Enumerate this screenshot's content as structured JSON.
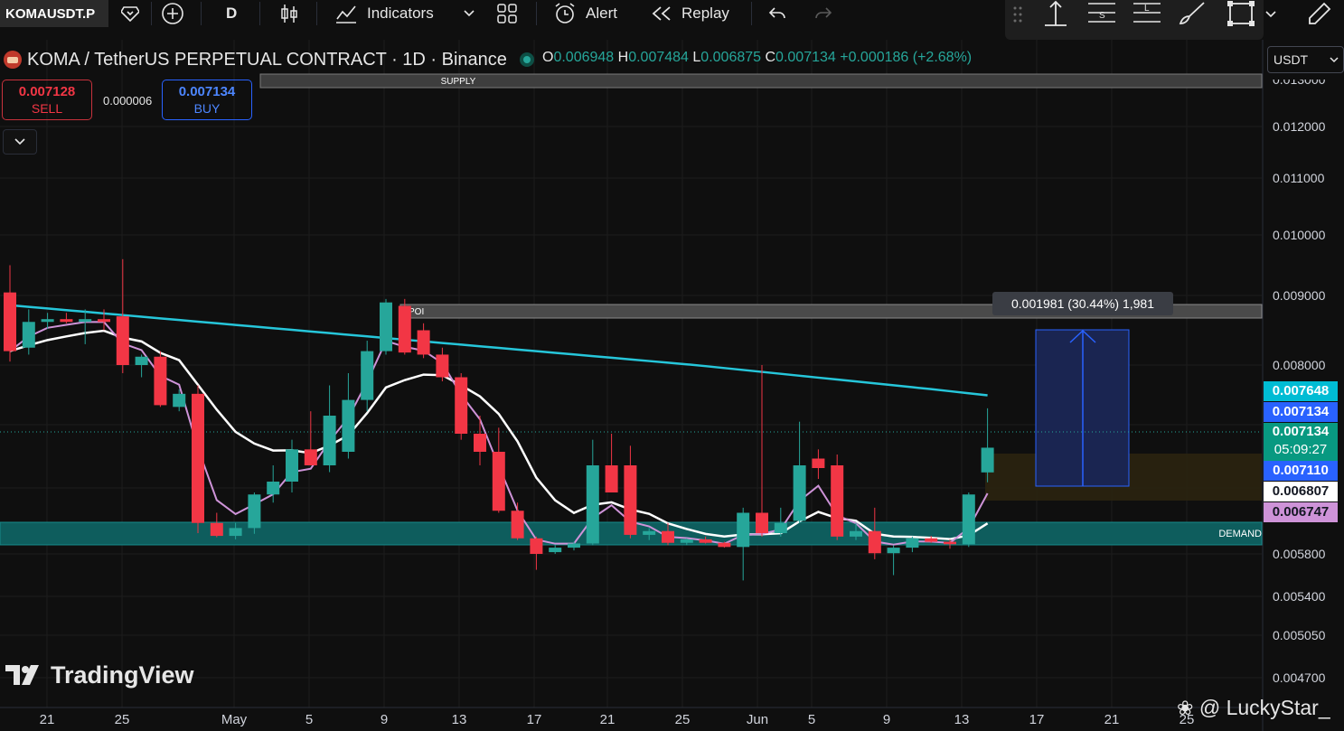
{
  "toolbar": {
    "symbol": "KOMAUSDT.P",
    "interval": "D",
    "indicators_label": "Indicators",
    "alert_label": "Alert",
    "replay_label": "Replay"
  },
  "legend": {
    "title": "KOMA / TetherUS PERPETUAL CONTRACT · 1D · Binance",
    "o_key": "O",
    "o_val": "0.006948",
    "h_key": "H",
    "h_val": "0.007484",
    "l_key": "L",
    "l_val": "0.006875",
    "c_key": "C",
    "c_val": "0.007134",
    "change": "+0.000186 (+2.68%)"
  },
  "trade": {
    "sell_price": "0.007128",
    "sell_label": "SELL",
    "spread": "0.000006",
    "buy_price": "0.007134",
    "buy_label": "BUY"
  },
  "currency": "USDT",
  "zones": {
    "supply": "SUPPLY",
    "poi": "POI",
    "demand": "DEMAND"
  },
  "measure": {
    "label": "0.001981 (30.44%) 1,981"
  },
  "price_axis": {
    "ticks": [
      "0.013000",
      "0.012000",
      "0.011000",
      "0.010000",
      "0.009000",
      "0.008000",
      "0.005800",
      "0.005400",
      "0.005050",
      "0.004700"
    ],
    "labels": [
      {
        "text": "0.007648",
        "bg": "#00bcd4",
        "fg": "#ffffff"
      },
      {
        "text": "0.007134",
        "bg": "#2962ff",
        "fg": "#ffffff"
      },
      {
        "text": "0.007134",
        "bg": "#089981",
        "fg": "#ffffff",
        "sub": "05:09:27"
      },
      {
        "text": "0.007110",
        "bg": "#2962ff",
        "fg": "#ffffff"
      },
      {
        "text": "0.006807",
        "bg": "#ffffff",
        "fg": "#131722"
      },
      {
        "text": "0.006747",
        "bg": "#ce93d8",
        "fg": "#131722"
      }
    ]
  },
  "time_axis": [
    "21",
    "25",
    "May",
    "5",
    "9",
    "13",
    "17",
    "21",
    "25",
    "Jun",
    "5",
    "9",
    "13",
    "17",
    "21",
    "25"
  ],
  "branding": {
    "logo_text": "TradingView",
    "watermark": "@ LuckyStar_"
  },
  "colors": {
    "up": "#26a69a",
    "down": "#f23645",
    "ema_long": "#26c6da",
    "ema_mid": "#ffffff",
    "ema_short": "#ce93d8",
    "background": "#0f0f0f"
  },
  "candles": [
    {
      "o": 0.00905,
      "h": 0.0095,
      "l": 0.00805,
      "c": 0.0082
    },
    {
      "o": 0.00825,
      "h": 0.0088,
      "l": 0.00815,
      "c": 0.00862
    },
    {
      "o": 0.00862,
      "h": 0.00875,
      "l": 0.00852,
      "c": 0.00866
    },
    {
      "o": 0.00866,
      "h": 0.00875,
      "l": 0.0086,
      "c": 0.00862
    },
    {
      "o": 0.00862,
      "h": 0.0088,
      "l": 0.0083,
      "c": 0.00866
    },
    {
      "o": 0.00866,
      "h": 0.0088,
      "l": 0.0085,
      "c": 0.00862
    },
    {
      "o": 0.0087,
      "h": 0.0096,
      "l": 0.0079,
      "c": 0.008
    },
    {
      "o": 0.008,
      "h": 0.00815,
      "l": 0.00785,
      "c": 0.00812
    },
    {
      "o": 0.00812,
      "h": 0.0082,
      "l": 0.0075,
      "c": 0.00752
    },
    {
      "o": 0.0075,
      "h": 0.0077,
      "l": 0.00745,
      "c": 0.00765
    },
    {
      "o": 0.00765,
      "h": 0.00775,
      "l": 0.0064,
      "c": 0.0065
    },
    {
      "o": 0.0065,
      "h": 0.0066,
      "l": 0.00628,
      "c": 0.00632
    },
    {
      "o": 0.00632,
      "h": 0.0065,
      "l": 0.00622,
      "c": 0.00645
    },
    {
      "o": 0.00645,
      "h": 0.0068,
      "l": 0.00638,
      "c": 0.00678
    },
    {
      "o": 0.00678,
      "h": 0.007,
      "l": 0.0067,
      "c": 0.00688
    },
    {
      "o": 0.00688,
      "h": 0.0072,
      "l": 0.0068,
      "c": 0.00712
    },
    {
      "o": 0.00712,
      "h": 0.00745,
      "l": 0.007,
      "c": 0.007
    },
    {
      "o": 0.007,
      "h": 0.00775,
      "l": 0.00695,
      "c": 0.0074
    },
    {
      "o": 0.0071,
      "h": 0.0079,
      "l": 0.00705,
      "c": 0.00758
    },
    {
      "o": 0.00758,
      "h": 0.00835,
      "l": 0.00745,
      "c": 0.0082
    },
    {
      "o": 0.0082,
      "h": 0.00895,
      "l": 0.00815,
      "c": 0.0089
    },
    {
      "o": 0.00885,
      "h": 0.00895,
      "l": 0.00815,
      "c": 0.00818
    },
    {
      "o": 0.0085,
      "h": 0.0086,
      "l": 0.0081,
      "c": 0.00815
    },
    {
      "o": 0.00815,
      "h": 0.00825,
      "l": 0.0078,
      "c": 0.00785
    },
    {
      "o": 0.00785,
      "h": 0.0079,
      "l": 0.0072,
      "c": 0.00725
    },
    {
      "o": 0.00725,
      "h": 0.0074,
      "l": 0.007,
      "c": 0.0071
    },
    {
      "o": 0.0071,
      "h": 0.0073,
      "l": 0.0066,
      "c": 0.00662
    },
    {
      "o": 0.00662,
      "h": 0.0067,
      "l": 0.0062,
      "c": 0.00625
    },
    {
      "o": 0.00625,
      "h": 0.0063,
      "l": 0.00565,
      "c": 0.0058
    },
    {
      "o": 0.00585,
      "h": 0.00605,
      "l": 0.0058,
      "c": 0.00598
    },
    {
      "o": 0.00598,
      "h": 0.00615,
      "l": 0.0059,
      "c": 0.0061
    },
    {
      "o": 0.0061,
      "h": 0.0072,
      "l": 0.00605,
      "c": 0.007
    },
    {
      "o": 0.007,
      "h": 0.00725,
      "l": 0.0069,
      "c": 0.0068
    },
    {
      "o": 0.007,
      "h": 0.00715,
      "l": 0.00625,
      "c": 0.00635
    },
    {
      "o": 0.00635,
      "h": 0.00645,
      "l": 0.0062,
      "c": 0.00642
    },
    {
      "o": 0.00642,
      "h": 0.0065,
      "l": 0.00605,
      "c": 0.00612
    },
    {
      "o": 0.00612,
      "h": 0.00625,
      "l": 0.00605,
      "c": 0.00622
    },
    {
      "o": 0.00622,
      "h": 0.0063,
      "l": 0.0061,
      "c": 0.00612
    },
    {
      "o": 0.00612,
      "h": 0.00615,
      "l": 0.00598,
      "c": 0.006
    },
    {
      "o": 0.006,
      "h": 0.00665,
      "l": 0.00555,
      "c": 0.0066
    },
    {
      "o": 0.0066,
      "h": 0.008,
      "l": 0.0063,
      "c": 0.0064
    },
    {
      "o": 0.0064,
      "h": 0.00665,
      "l": 0.0063,
      "c": 0.0065
    },
    {
      "o": 0.00652,
      "h": 0.00735,
      "l": 0.0065,
      "c": 0.007
    },
    {
      "o": 0.00705,
      "h": 0.00712,
      "l": 0.0069,
      "c": 0.00698
    },
    {
      "o": 0.007,
      "h": 0.00708,
      "l": 0.0062,
      "c": 0.0063
    },
    {
      "o": 0.0063,
      "h": 0.0065,
      "l": 0.0062,
      "c": 0.00642
    },
    {
      "o": 0.00642,
      "h": 0.00665,
      "l": 0.00575,
      "c": 0.00582
    },
    {
      "o": 0.00582,
      "h": 0.00605,
      "l": 0.0056,
      "c": 0.00598
    },
    {
      "o": 0.00598,
      "h": 0.0063,
      "l": 0.00585,
      "c": 0.00625
    },
    {
      "o": 0.00625,
      "h": 0.00632,
      "l": 0.00612,
      "c": 0.00615
    },
    {
      "o": 0.00615,
      "h": 0.00622,
      "l": 0.00595,
      "c": 0.00608
    },
    {
      "o": 0.00608,
      "h": 0.0068,
      "l": 0.006,
      "c": 0.00678
    },
    {
      "o": 0.006948,
      "h": 0.007484,
      "l": 0.006875,
      "c": 0.007134
    }
  ]
}
